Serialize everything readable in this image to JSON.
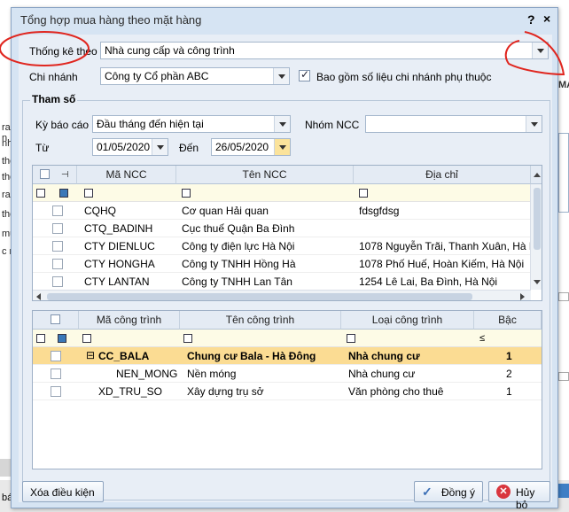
{
  "dialog": {
    "title": "Tổng hợp mua hàng theo mặt hàng",
    "help_label": "?",
    "close_label": "×"
  },
  "top": {
    "thong_ke_label": "Thống kê theo",
    "thong_ke_value": "Nhà cung cấp và công trình",
    "chi_nhanh_label": "Chi nhánh",
    "chi_nhanh_value": "Công ty Cổ phần ABC",
    "include_branch_label": "Bao gồm số liệu chi nhánh phụ thuộc",
    "include_branch_checked": true
  },
  "params": {
    "group_title": "Tham số",
    "ky_bao_cao_label": "Kỳ báo cáo",
    "ky_bao_cao_value": "Đầu tháng đến hiện tại",
    "nhom_ncc_label": "Nhóm NCC",
    "nhom_ncc_value": "",
    "tu_label": "Từ",
    "tu_value": "01/05/2020",
    "den_label": "Đến",
    "den_value": "26/05/2020"
  },
  "supplier_grid": {
    "columns": [
      "Mã NCC",
      "Tên NCC",
      "Địa chỉ"
    ],
    "rows": [
      {
        "ma": "CQHQ",
        "ten": "Cơ quan Hải quan",
        "dia_chi": "fdsgfdsg"
      },
      {
        "ma": "CTQ_BADINH",
        "ten": "Cục thuế Quận Ba Đình",
        "dia_chi": ""
      },
      {
        "ma": "CTY DIENLUC",
        "ten": "Công ty điện lực Hà Nội",
        "dia_chi": "1078 Nguyễn Trãi, Thanh Xuân, Hà N"
      },
      {
        "ma": "CTY HONGHA",
        "ten": "Công ty TNHH Hồng Hà",
        "dia_chi": "1078 Phố Huế, Hoàn Kiếm, Hà Nội"
      },
      {
        "ma": "CTY LANTAN",
        "ten": "Công ty TNHH Lan Tân",
        "dia_chi": "1254 Lê Lai, Ba Đình, Hà Nội"
      }
    ]
  },
  "project_grid": {
    "columns": [
      "Mã công trình",
      "Tên công trình",
      "Loại công trình",
      "Bậc"
    ],
    "filter_bac": "≤",
    "rows": [
      {
        "ma": "CC_BALA",
        "ten": "Chung cư Bala - Hà Đông",
        "loai": "Nhà chung cư",
        "bac": "1",
        "expander": "⊟"
      },
      {
        "ma": "NEN_MONG",
        "ten": "Nền móng",
        "loai": "Nhà chung cư",
        "bac": "2",
        "expander": ""
      },
      {
        "ma": "XD_TRU_SO",
        "ten": "Xây dựng trụ sở",
        "loai": "Văn phòng cho thuê",
        "bac": "1",
        "expander": ""
      }
    ]
  },
  "buttons": {
    "clear": "Xóa điều kiện",
    "ok": "Đồng ý",
    "cancel": "Hủy bỏ"
  },
  "background": {
    "left_lines": [
      "ra n",
      "nhà",
      "the",
      "the",
      "ra t",
      "the",
      "mua",
      "c m"
    ],
    "bottom_left": "bác",
    "right_top": "MA"
  }
}
